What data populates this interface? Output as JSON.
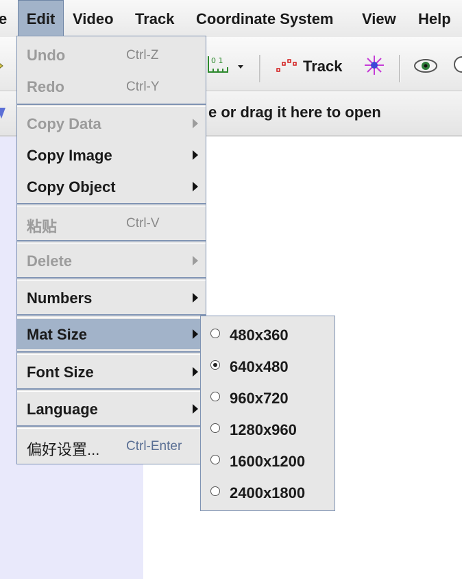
{
  "menubar": {
    "items": [
      {
        "label": "e"
      },
      {
        "label": "Edit"
      },
      {
        "label": "Video"
      },
      {
        "label": "Track"
      },
      {
        "label": "Coordinate System"
      },
      {
        "label": "View"
      },
      {
        "label": "Help"
      }
    ]
  },
  "toolbar": {
    "track_label": "Track",
    "calibration_icon_text": "0 1"
  },
  "hint": {
    "text": "e or drag it here to open"
  },
  "edit_menu": {
    "undo": {
      "label": "Undo",
      "shortcut": "Ctrl-Z"
    },
    "redo": {
      "label": "Redo",
      "shortcut": "Ctrl-Y"
    },
    "copy_data": {
      "label": "Copy Data"
    },
    "copy_image": {
      "label": "Copy Image"
    },
    "copy_object": {
      "label": "Copy Object"
    },
    "paste": {
      "label": "粘贴",
      "shortcut": "Ctrl-V"
    },
    "delete": {
      "label": "Delete"
    },
    "numbers": {
      "label": "Numbers"
    },
    "mat_size": {
      "label": "Mat Size"
    },
    "font_size": {
      "label": "Font Size"
    },
    "language": {
      "label": "Language"
    },
    "preferences": {
      "label": "偏好设置...",
      "shortcut": "Ctrl-Enter"
    }
  },
  "mat_size_submenu": {
    "options": [
      {
        "label": "480x360",
        "selected": false
      },
      {
        "label": "640x480",
        "selected": true
      },
      {
        "label": "960x720",
        "selected": false
      },
      {
        "label": "1280x960",
        "selected": false
      },
      {
        "label": "1600x1200",
        "selected": false
      },
      {
        "label": "2400x1800",
        "selected": false
      }
    ]
  },
  "colors": {
    "menu_highlight": "#a2b3c9",
    "menu_border": "#7f93b3",
    "menu_background": "#e7e7e7",
    "side_panel": "#e9e9fb"
  }
}
